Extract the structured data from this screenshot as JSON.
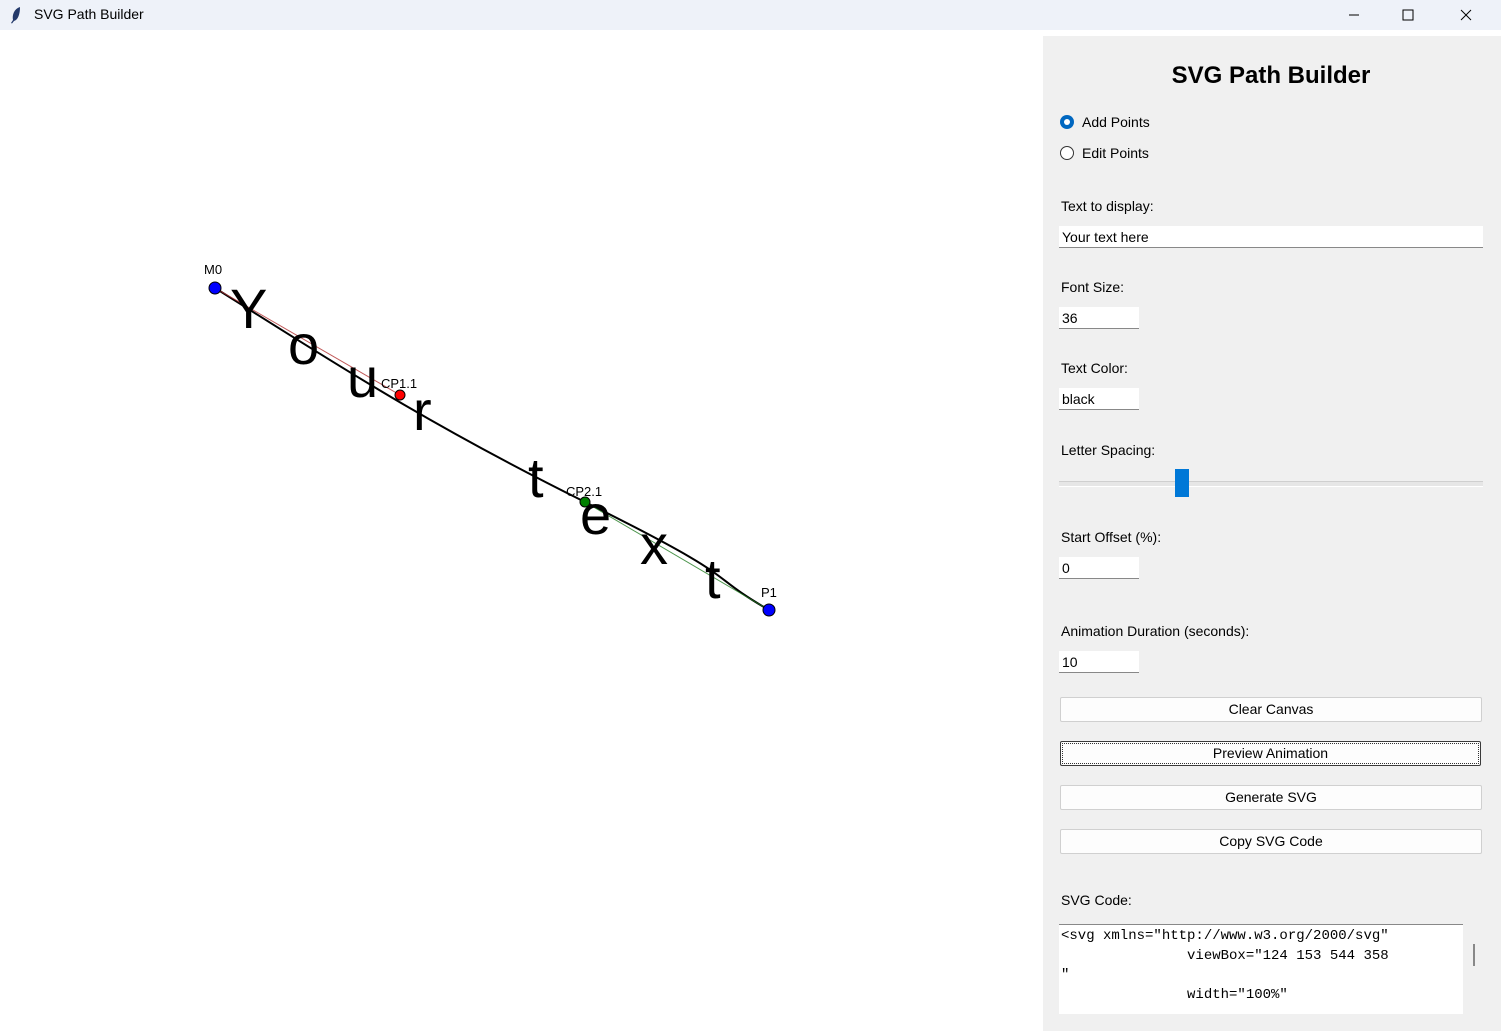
{
  "window": {
    "title": "SVG Path Builder"
  },
  "canvas": {
    "text": "Your text here",
    "points": [
      {
        "label": "M0",
        "color": "#0000ff"
      },
      {
        "label": "CP1.1",
        "color": "#ff0000"
      },
      {
        "label": "CP2.1",
        "color": "#008000"
      },
      {
        "label": "P1",
        "color": "#0000ff"
      }
    ],
    "glyphs": [
      "Y",
      "o",
      "u",
      "r",
      "t",
      "e",
      "x",
      "t"
    ]
  },
  "panel": {
    "title": "SVG Path Builder",
    "mode": {
      "add_label": "Add Points",
      "edit_label": "Edit Points",
      "selected": "add"
    },
    "text_label": "Text to display:",
    "text_value": "Your text here",
    "font_size_label": "Font Size:",
    "font_size_value": "36",
    "color_label": "Text Color:",
    "color_value": "black",
    "spacing_label": "Letter Spacing:",
    "start_offset_label": "Start Offset (%):",
    "start_offset_value": "0",
    "duration_label": "Animation Duration (seconds):",
    "duration_value": "10",
    "buttons": {
      "clear": "Clear Canvas",
      "preview": "Preview Animation",
      "generate": "Generate SVG",
      "copy": "Copy SVG Code"
    },
    "code_label": "SVG Code:",
    "code_text": "<svg xmlns=\"http://www.w3.org/2000/svg\"\n               viewBox=\"124 153 544 358\n\"\n               width=\"100%\""
  }
}
